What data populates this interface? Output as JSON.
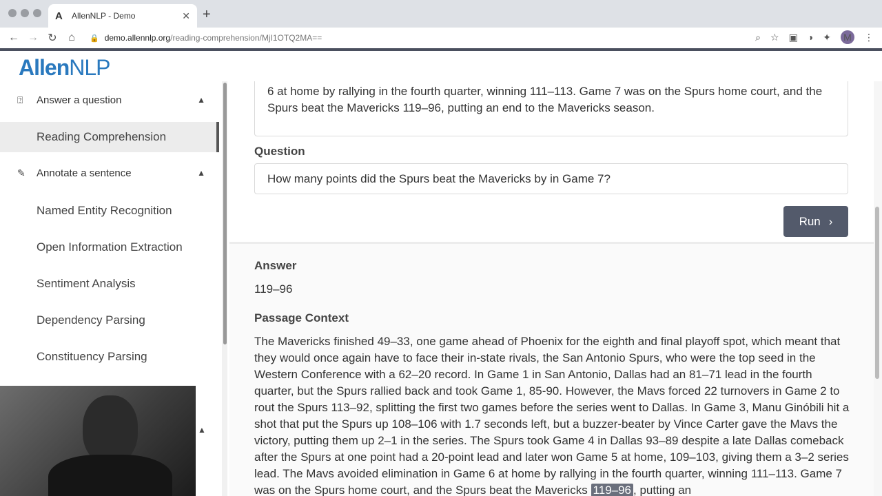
{
  "browser": {
    "tab_title": "AllenNLP - Demo",
    "tab_favicon": "A",
    "url_host": "demo.allennlp.org",
    "url_path": "/reading-comprehension/MjI1OTQ2MA==",
    "profile_initial": "M"
  },
  "app": {
    "logo_bold": "Allen",
    "logo_light": "NLP"
  },
  "sidebar": {
    "groups": [
      {
        "label": "Answer a question",
        "icon": "question-box-icon"
      },
      {
        "label": "Annotate a sentence",
        "icon": "pencil-icon"
      }
    ],
    "items": [
      {
        "label": "Reading Comprehension",
        "active": true
      },
      {
        "label": "Named Entity Recognition"
      },
      {
        "label": "Open Information Extraction"
      },
      {
        "label": "Sentiment Analysis"
      },
      {
        "label": "Dependency Parsing"
      },
      {
        "label": "Constituency Parsing"
      }
    ]
  },
  "main": {
    "passage_tail": "6 at home by rallying in the fourth quarter, winning 111–113. Game 7 was on the Spurs home court, and the Spurs beat the Mavericks 119–96, putting an end to the Mavericks season.",
    "question_label": "Question",
    "question_value": "How many points did the Spurs beat the Mavericks by in Game 7?",
    "run_label": "Run",
    "answer_label": "Answer",
    "answer_value": "119–96",
    "context_label": "Passage Context",
    "context_before": "The Mavericks finished 49–33, one game ahead of Phoenix for the eighth and final playoff spot, which meant that they would once again have to face their in-state rivals, the San Antonio Spurs, who were the top seed in the Western Conference with a 62–20 record. In Game 1 in San Antonio, Dallas had an 81–71 lead in the fourth quarter, but the Spurs rallied back and took Game 1, 85-90. However, the Mavs forced 22 turnovers in Game 2 to rout the Spurs 113–92, splitting the first two games before the series went to Dallas. In Game 3, Manu Ginóbili hit a shot that put the Spurs up 108–106 with 1.7 seconds left, but a buzzer-beater by Vince Carter gave the Mavs the victory, putting them up 2–1 in the series. The Spurs took Game 4 in Dallas 93–89 despite a late Dallas comeback after the Spurs at one point had a 20-point lead and later won Game 5 at home, 109–103, giving them a 3–2 series lead. The Mavs avoided elimination in Game 6 at home by rallying in the fourth quarter, winning 111–113. Game 7 was on the Spurs home court, and the Spurs beat the Mavericks ",
    "context_highlight": "119–96",
    "context_after": ", putting an"
  }
}
